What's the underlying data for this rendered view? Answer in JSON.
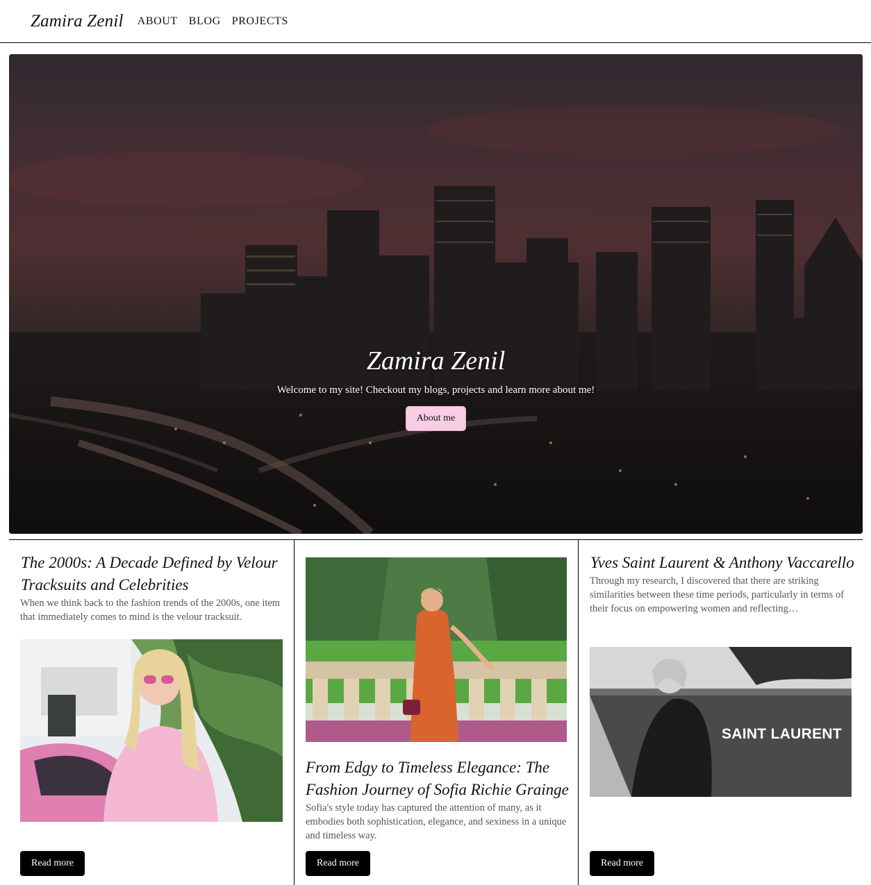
{
  "nav": {
    "brand": "Zamira Zenil",
    "links": [
      "ABOUT",
      "BLOG",
      "PROJECTS"
    ]
  },
  "hero": {
    "title": "Zamira Zenil",
    "subtitle": "Welcome to my site! Checkout my blogs, projects and learn more about me!",
    "button": "About me",
    "button_color": "#f7cde4"
  },
  "cards": [
    {
      "title": "The 2000s: A Decade Defined by Velour Tracksuits and Celebrities",
      "text": "When we think back to the fashion trends of the 2000s, one item that immediately comes to mind is the velour tracksuit.",
      "button": "Read more"
    },
    {
      "title": "From Edgy to Timeless Elegance: The Fashion Journey of Sofia Richie Grainge",
      "text": "Sofia's style today has captured the attention of many, as it embodies both sophistication, elegance, and sexiness in a unique and timeless way.",
      "button": "Read more"
    },
    {
      "title": "Yves Saint Laurent & Anthony Vaccarello",
      "text": "Through my research, I discovered that there are striking similarities between these time periods, particularly in terms of their focus on empowering women and reflecting…",
      "image_caption": "SAINT LAURENT",
      "button": "Read more"
    }
  ]
}
